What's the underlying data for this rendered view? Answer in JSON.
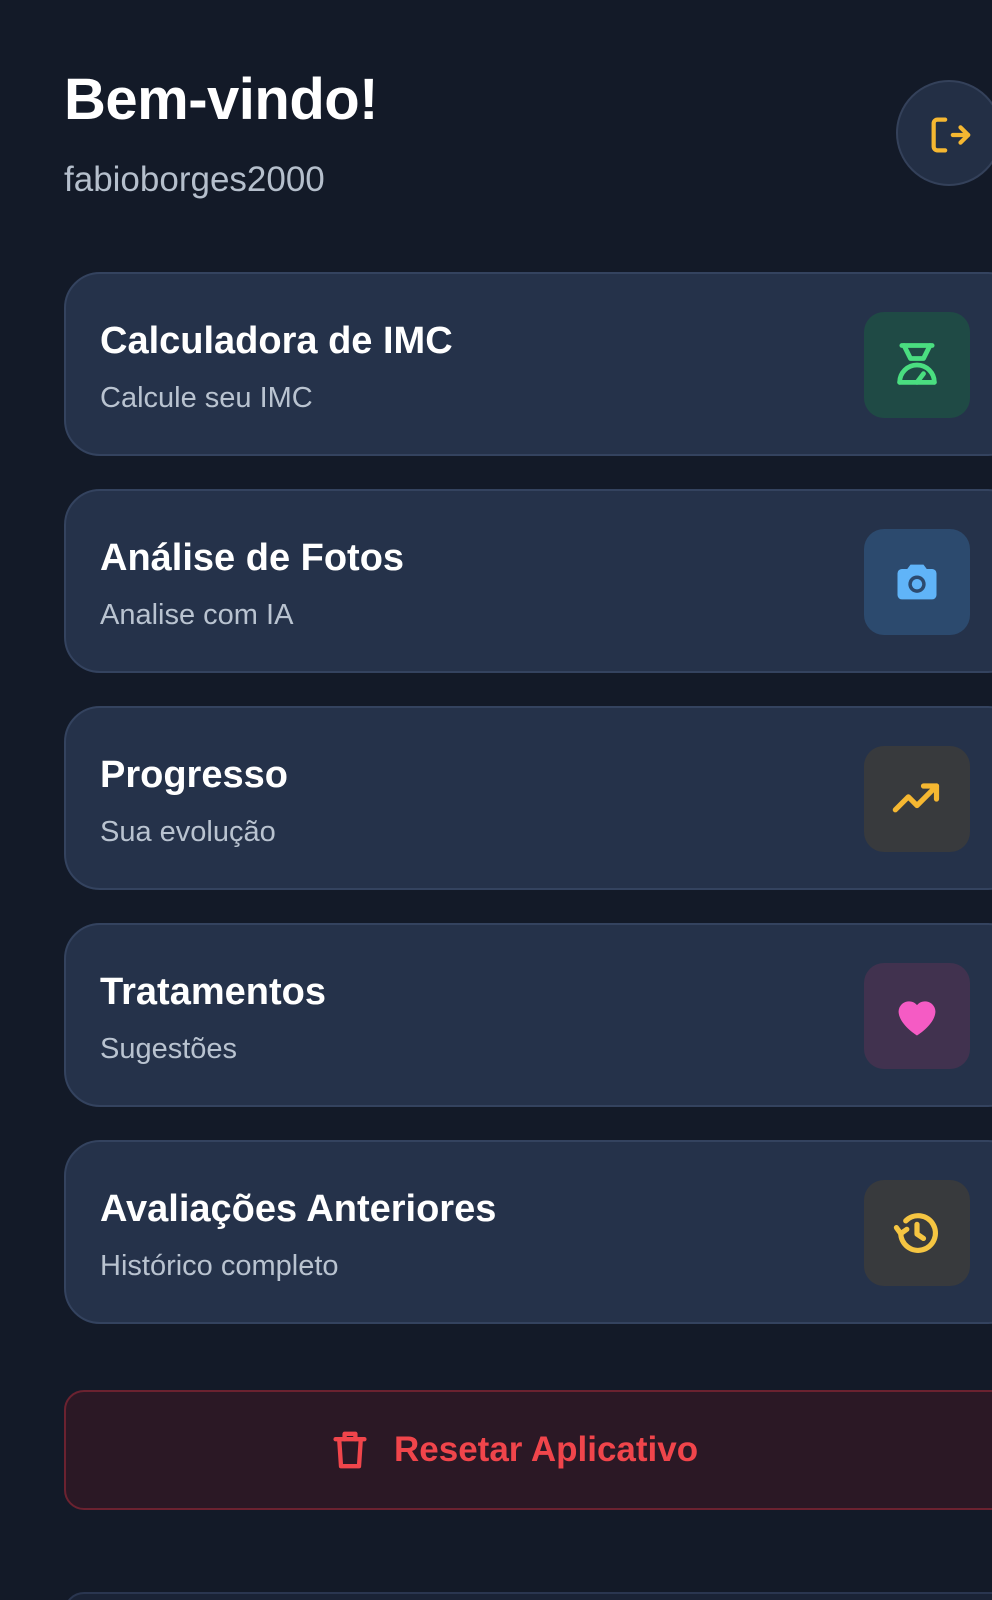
{
  "header": {
    "title": "Bem-vindo!",
    "username": "fabioborges2000",
    "logout_icon": "logout-icon"
  },
  "menu": [
    {
      "title": "Calculadora de IMC",
      "subtitle": "Calcule seu IMC",
      "icon": "scale-icon",
      "icon_color": "#4ade80",
      "icon_bg": "#1f4a45"
    },
    {
      "title": "Análise de Fotos",
      "subtitle": "Analise com IA",
      "icon": "camera-icon",
      "icon_color": "#60b4f8",
      "icon_bg": "#2c4a6e"
    },
    {
      "title": "Progresso",
      "subtitle": "Sua evolução",
      "icon": "trending-up-icon",
      "icon_color": "#f5b731",
      "icon_bg": "#383a3d"
    },
    {
      "title": "Tratamentos",
      "subtitle": "Sugestões",
      "icon": "heart-icon",
      "icon_color": "#f55bc4",
      "icon_bg": "#41324f"
    },
    {
      "title": "Avaliações Anteriores",
      "subtitle": "Histórico completo",
      "icon": "history-icon",
      "icon_color": "#f5c542",
      "icon_bg": "#383a3d"
    }
  ],
  "reset": {
    "label": "Resetar Aplicativo",
    "icon": "trash-icon",
    "color": "#f0454b"
  },
  "colors": {
    "background": "#131a28",
    "card": "#25324a",
    "logout_accent": "#f5b731"
  }
}
